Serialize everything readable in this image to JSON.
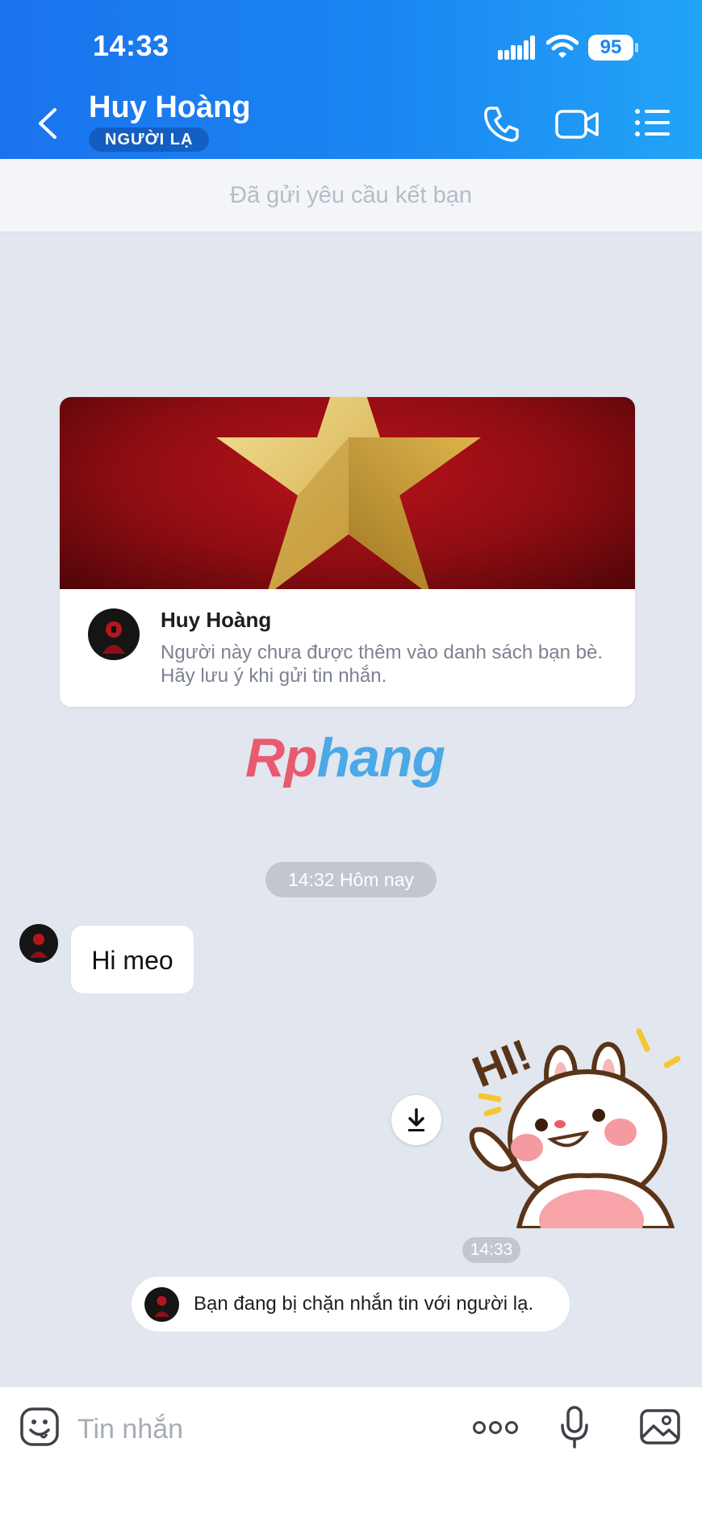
{
  "status_bar": {
    "time": "14:33",
    "battery": "95",
    "icons": [
      "signal-icon",
      "wifi-icon",
      "battery-icon"
    ]
  },
  "header": {
    "contact_name": "Huy Hoàng",
    "badge": "NGƯỜI LẠ",
    "icons": [
      "back-arrow-icon",
      "phone-icon",
      "video-camera-icon",
      "list-menu-icon"
    ]
  },
  "friend_request": {
    "text": "Đã gửi yêu cầu kết bạn"
  },
  "profile_card": {
    "name": "Huy Hoàng",
    "description": "Người này chưa được thêm vào danh sách bạn bè. Hãy lưu ý khi gửi tin nhắn."
  },
  "watermark": {
    "part1": "Rp",
    "part2": "hang"
  },
  "chat": {
    "date_divider": "14:32 Hôm nay",
    "messages": [
      {
        "direction": "incoming",
        "text": "Hi meo"
      },
      {
        "direction": "outgoing",
        "type": "sticker",
        "sticker_text": "HI!",
        "time": "14:33"
      }
    ],
    "block_notice": "Bạn đang bị chặn nhắn tin với người lạ."
  },
  "input_bar": {
    "placeholder": "Tin nhắn",
    "icons": [
      "emoji-icon",
      "more-dots-icon",
      "microphone-icon",
      "image-icon"
    ]
  },
  "colors": {
    "header_start": "#1a73ee",
    "header_end": "#23a4f7",
    "chat_background": "#e1e6ef",
    "cover_red": "#b9121a",
    "star_gold": "#e9c54d"
  }
}
